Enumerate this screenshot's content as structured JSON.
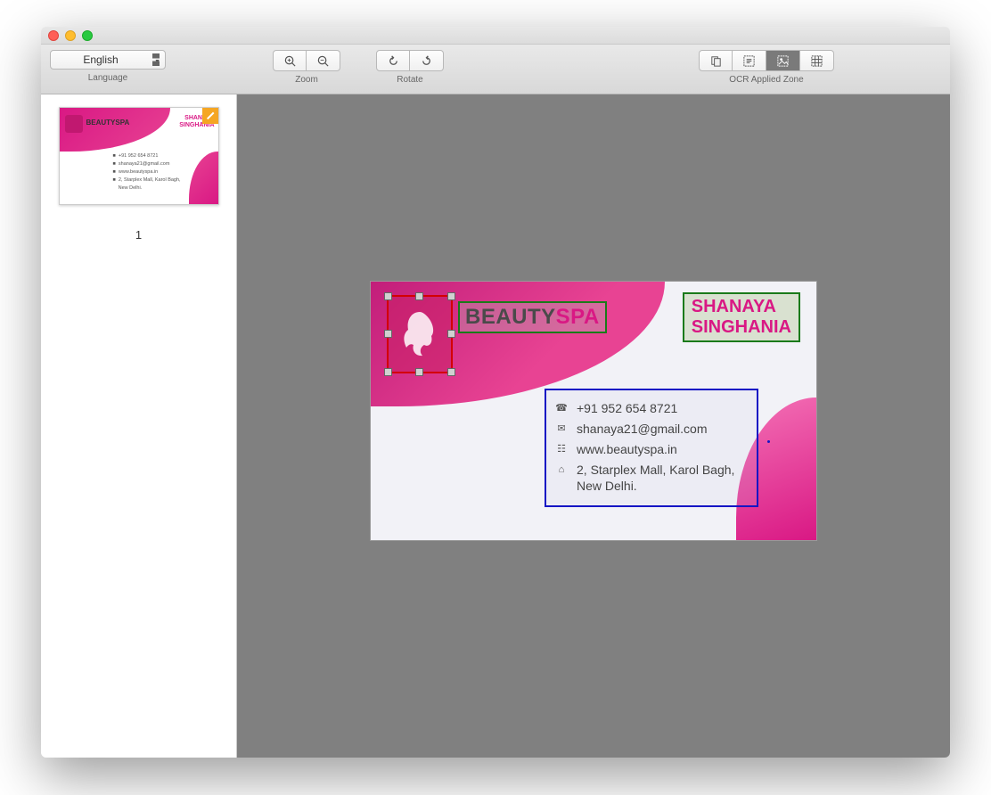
{
  "toolbar": {
    "language": {
      "selected": "English",
      "label": "Language"
    },
    "zoom": {
      "label": "Zoom"
    },
    "rotate": {
      "label": "Rotate"
    },
    "ocr": {
      "label": "OCR Applied Zone"
    }
  },
  "sidebar": {
    "page_number": "1"
  },
  "card": {
    "brand_a": "BEAUTY",
    "brand_b": "SPA",
    "name_line1": "SHANAYA",
    "name_line2": "SINGHANIA",
    "phone": "+91 952 654 8721",
    "email": "shanaya21@gmail.com",
    "website": "www.beautyspa.in",
    "address": "2, Starplex Mall, Karol Bagh, New Delhi."
  },
  "thumb": {
    "brand": "BEAUTYSPA",
    "name": "SHANAYA\nSINGHANIA",
    "phone": "+91 952 654 8721",
    "email": "shanaya21@gmail.com",
    "web": "www.beautyspa.in",
    "addr": "2, Starplex Mall, Karol Bagh,\nNew Delhi."
  }
}
